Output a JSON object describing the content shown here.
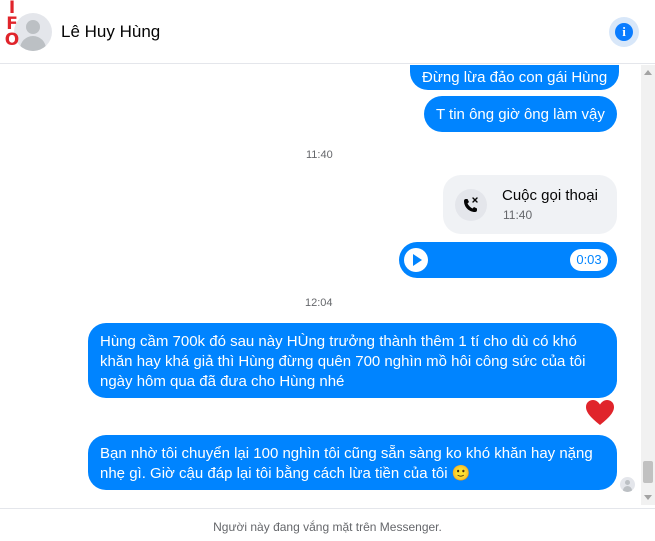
{
  "header": {
    "watermark": "IFO",
    "contact_name": "Lê Huy Hùng",
    "info_icon": "info-icon",
    "info_glyph": "i"
  },
  "messages": {
    "msg1": "Đừng lừa đảo con gái Hùng",
    "msg2": "T tin ông giờ ông làm vậy",
    "timestamp1": "11:40",
    "call": {
      "icon": "missed-call-icon",
      "title": "Cuộc gọi thoại",
      "time": "11:40"
    },
    "audio": {
      "icon": "play-icon",
      "duration": "0:03"
    },
    "timestamp2": "12:04",
    "msg3": "Hùng cầm 700k đó  sau này HÙng trưởng thành thêm 1 tí cho dù có khó khăn hay khá giả thì Hùng đừng quên 700 nghìn mồ hôi công sức của tôi ngày hôm qua đã đưa cho Hùng nhé",
    "reaction": "heart-reaction-icon",
    "msg4": "Bạn nhờ tôi chuyển lại 100 nghìn tôi cũng sẵn sàng ko khó khăn hay nặng nhẹ gì. Giờ cậu đáp lại tôi bằng cách lừa tiền của tôi",
    "msg4_emoji": "🙂",
    "seen_icon": "seen-avatar-icon"
  },
  "footer": {
    "status": "Người này đang vắng mặt trên Messenger."
  },
  "colors": {
    "bubble": "#0084ff",
    "heart": "#e0242b",
    "watermark": "#e0242b"
  }
}
